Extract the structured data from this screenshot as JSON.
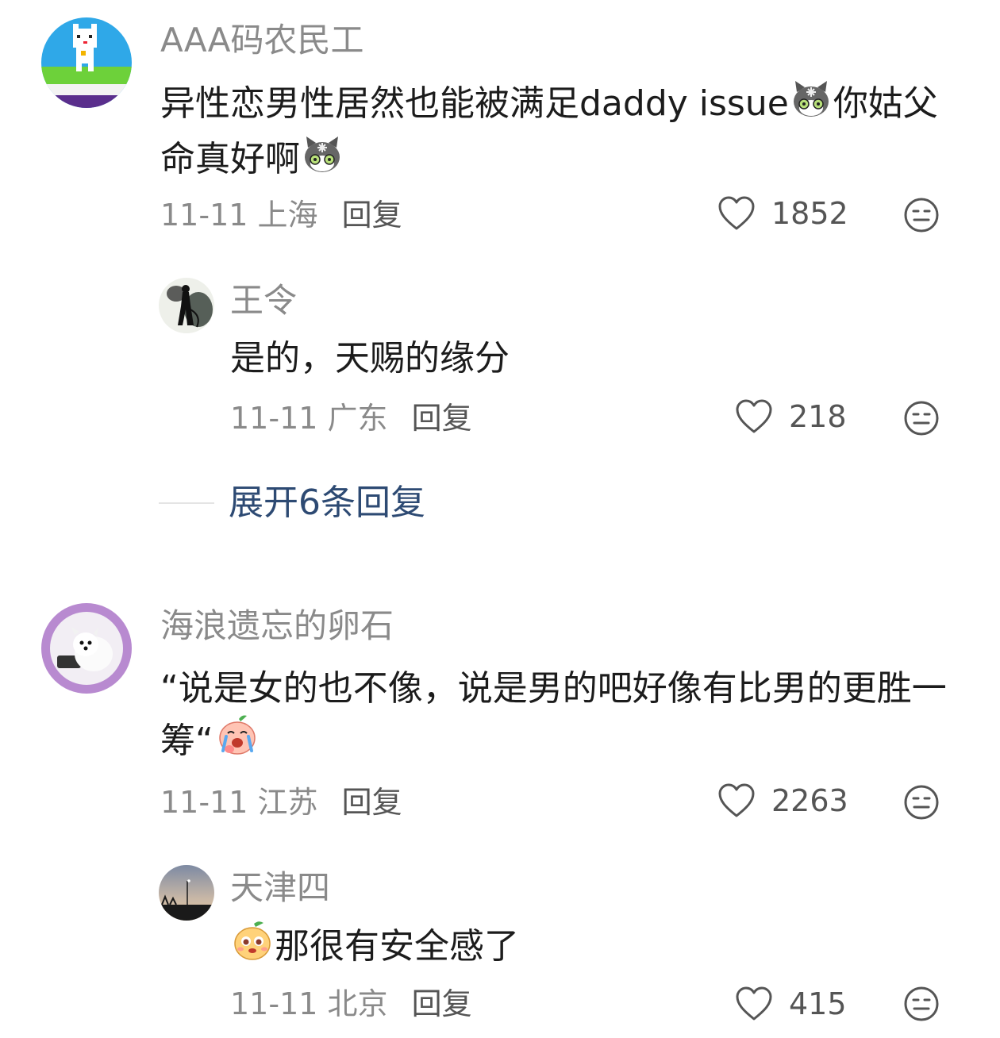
{
  "comments": [
    {
      "username": "AAA码农民工",
      "text_parts": [
        "异性恋男性居然也能被满足daddy issue",
        "你姑父命真好啊"
      ],
      "date": "11-11",
      "location": "上海",
      "reply_label": "回复",
      "likes": "1852",
      "emoji": "gray-cat-emoji",
      "avatar": "pixel-cat-avatar",
      "replies": [
        {
          "username": "王令",
          "text": "是的，天赐的缘分",
          "date": "11-11",
          "location": "广东",
          "reply_label": "回复",
          "likes": "218",
          "avatar": "ink-painting-avatar"
        }
      ],
      "expand_label": "展开6条回复"
    },
    {
      "username": "海浪遗忘的卵石",
      "text_parts": [
        "“说是女的也不像，说是男的吧好像有比男的更胜一筹“"
      ],
      "date": "11-11",
      "location": "江苏",
      "reply_label": "回复",
      "likes": "2263",
      "emoji": "crying-peach-emoji",
      "avatar": "white-dog-avatar",
      "replies": [
        {
          "username": "天津四",
          "text": "那很有安全感了",
          "date": "11-11",
          "location": "北京",
          "reply_label": "回复",
          "likes": "415",
          "emoji": "peach-face-emoji",
          "avatar": "dusk-sky-avatar"
        }
      ]
    }
  ],
  "icons": {
    "like": "heart-outline-icon",
    "dislike": "meh-face-icon"
  },
  "colors": {
    "username": "#8a8a8a",
    "expand_link": "#2d4a73",
    "text": "#1c1c1c"
  }
}
